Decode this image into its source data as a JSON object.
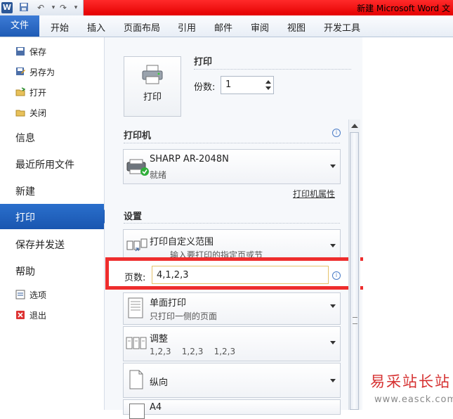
{
  "window": {
    "title": "新建 Microsoft Word 文"
  },
  "qat": {
    "logo": "W"
  },
  "ribbon": {
    "file_tab": "文件",
    "tabs": [
      "开始",
      "插入",
      "页面布局",
      "引用",
      "邮件",
      "审阅",
      "视图",
      "开发工具"
    ]
  },
  "nav": {
    "small_top": [
      {
        "label": "保存",
        "icon": "save-icon"
      },
      {
        "label": "另存为",
        "icon": "save-as-icon"
      },
      {
        "label": "打开",
        "icon": "open-folder-icon"
      },
      {
        "label": "关闭",
        "icon": "close-folder-icon"
      }
    ],
    "big": [
      "信息",
      "最近所用文件",
      "新建",
      "打印",
      "保存并发送",
      "帮助"
    ],
    "small_bottom": [
      {
        "label": "选项",
        "icon": "options-icon"
      },
      {
        "label": "退出",
        "icon": "exit-icon"
      }
    ]
  },
  "print": {
    "button_label": "打印",
    "heading": "打印",
    "copies_label": "份数:",
    "copies_value": "1"
  },
  "printer": {
    "heading": "打印机",
    "name": "SHARP AR-2048N",
    "status": "就绪",
    "properties_link": "打印机属性"
  },
  "settings": {
    "heading": "设置",
    "range": {
      "title": "打印自定义范围",
      "subtitle": "输入要打印的指定页或节"
    },
    "pages_label": "页数:",
    "pages_value": "4,1,2,3",
    "sides": {
      "title": "单面打印",
      "subtitle": "只打印一侧的页面"
    },
    "collate": {
      "title": "调整",
      "subtitle": "1,2,3    1,2,3    1,2,3"
    },
    "orientation": {
      "title": "纵向"
    },
    "paper": {
      "title": "A4"
    }
  },
  "watermark": {
    "text": "易采站长站",
    "url": "www.easck.com"
  }
}
